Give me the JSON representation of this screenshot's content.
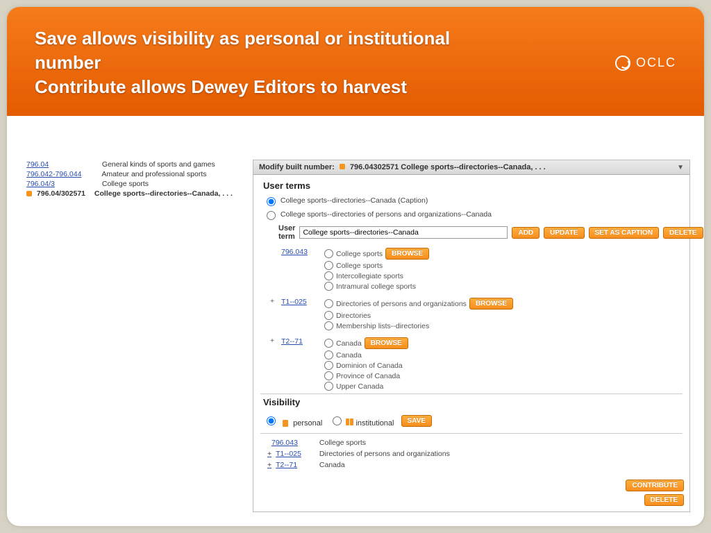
{
  "header": {
    "title_line1": "Save allows visibility as personal or institutional number",
    "title_line2": "Contribute allows Dewey Editors to harvest",
    "brand": "OCLC"
  },
  "tree": {
    "rows": [
      {
        "num": "796.04",
        "label": "General kinds of sports and games"
      },
      {
        "num": "796.042-796.044",
        "label": "Amateur and professional sports"
      },
      {
        "num": "796.04/3",
        "label": "College sports"
      },
      {
        "num": "796.04/302571",
        "label": "College sports--directories--Canada, . . .",
        "bold": true,
        "marker": true
      }
    ]
  },
  "panel": {
    "modify_label": "Modify built number:",
    "number_text": "796.04302571 College sports--directories--Canada, . . .",
    "user_terms_title": "User terms",
    "caption_opt": "College sports--directories--Canada  (Caption)",
    "alt_opt": "College sports--directories of persons and organizations--Canada",
    "user_term_label": "User term",
    "user_term_value": "College sports--directories--Canada",
    "buttons": {
      "add": "ADD",
      "update": "UPDATE",
      "set_caption": "SET AS CAPTION",
      "delete": "DELETE",
      "browse": "BROWSE",
      "save": "SAVE",
      "contribute": "CONTRIBUTE"
    },
    "class_groups": [
      {
        "plus": "",
        "link": "796.043",
        "options": [
          "College sports",
          "College sports",
          "Intercollegiate sports",
          "Intramural college sports"
        ],
        "browse_after": 0
      },
      {
        "plus": "+",
        "link": "T1--025",
        "options": [
          "Directories of persons and organizations",
          "Directories",
          "Membership lists--directories"
        ],
        "browse_after": 0
      },
      {
        "plus": "+",
        "link": "T2--71",
        "options": [
          "Canada",
          "Canada",
          "Dominion of Canada",
          "Province of Canada",
          "Upper Canada"
        ],
        "browse_after": 0
      }
    ],
    "visibility": {
      "title": "Visibility",
      "personal": "personal",
      "institutional": "institutional"
    },
    "summary": {
      "rows": [
        {
          "plus": "",
          "link": "796.043",
          "label": "College sports"
        },
        {
          "plus": "+",
          "link": "T1--025",
          "label": "Directories of persons and organizations"
        },
        {
          "plus": "+",
          "link": "T2--71",
          "label": "Canada"
        }
      ]
    }
  }
}
